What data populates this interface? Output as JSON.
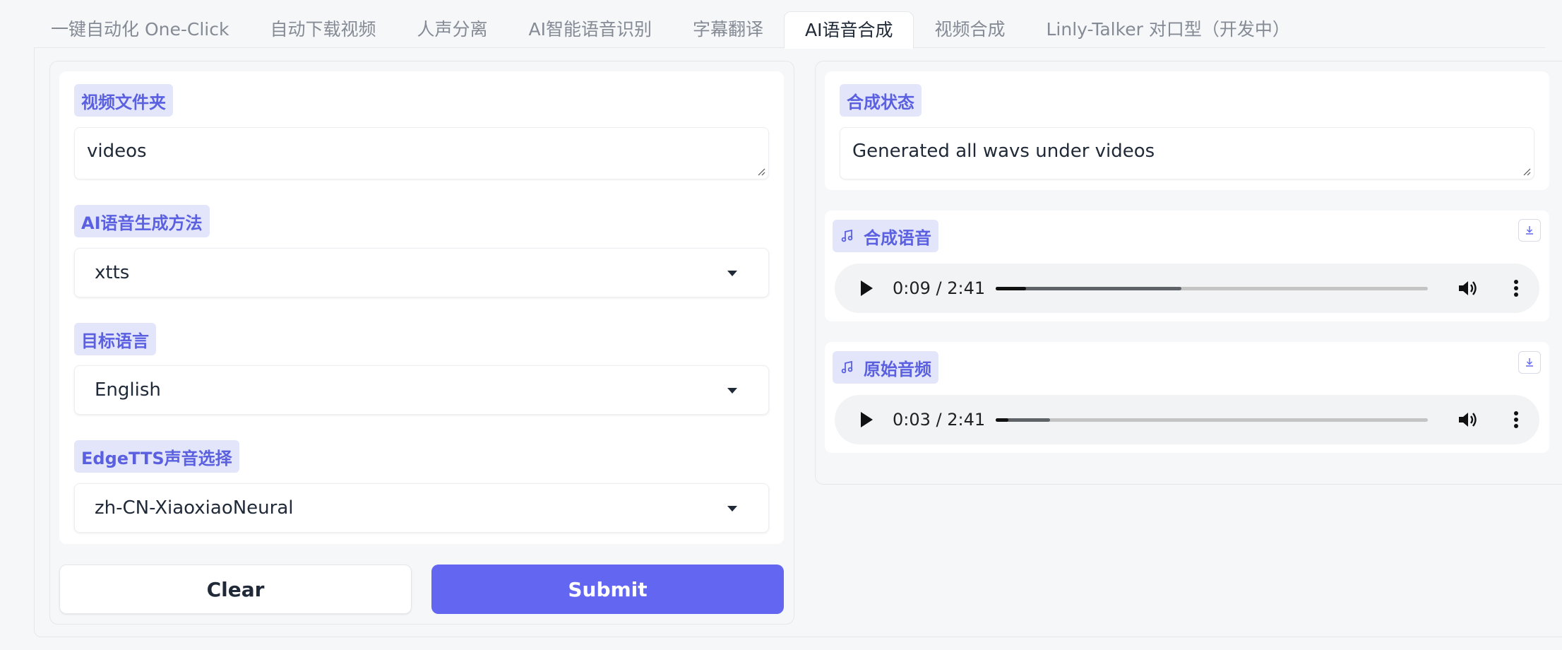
{
  "tabs": [
    {
      "label": "一键自动化 One-Click"
    },
    {
      "label": "自动下载视频"
    },
    {
      "label": "人声分离"
    },
    {
      "label": "AI智能语音识别"
    },
    {
      "label": "字幕翻译"
    },
    {
      "label": "AI语音合成",
      "active": true
    },
    {
      "label": "视频合成"
    },
    {
      "label": "Linly-Talker 对口型（开发中）"
    }
  ],
  "left": {
    "video_folder": {
      "label": "视频文件夹",
      "value": "videos"
    },
    "tts_method": {
      "label": "AI语音生成方法",
      "value": "xtts"
    },
    "target_language": {
      "label": "目标语言",
      "value": "English"
    },
    "edge_voice": {
      "label": "EdgeTTS声音选择",
      "value": "zh-CN-XiaoxiaoNeural"
    },
    "clear_label": "Clear",
    "submit_label": "Submit"
  },
  "right": {
    "status": {
      "label": "合成状态",
      "value": "Generated all wavs under videos"
    },
    "synth_audio": {
      "label": "合成语音",
      "time": "0:09 / 2:41",
      "played_fraction": 0.07,
      "buffered_fraction": 0.43
    },
    "original_audio": {
      "label": "原始音频",
      "time": "0:03 / 2:41",
      "played_fraction": 0.03,
      "buffered_fraction": 0.125
    }
  },
  "colors": {
    "accent": "#6366f1",
    "label_bg": "#e3e6fb",
    "label_text": "#5a60e0"
  },
  "icons": {
    "music_note": "music-note-icon",
    "download": "download-icon",
    "play": "play-icon",
    "volume": "volume-icon",
    "more": "more-vertical-icon",
    "caret": "chevron-down-icon"
  }
}
